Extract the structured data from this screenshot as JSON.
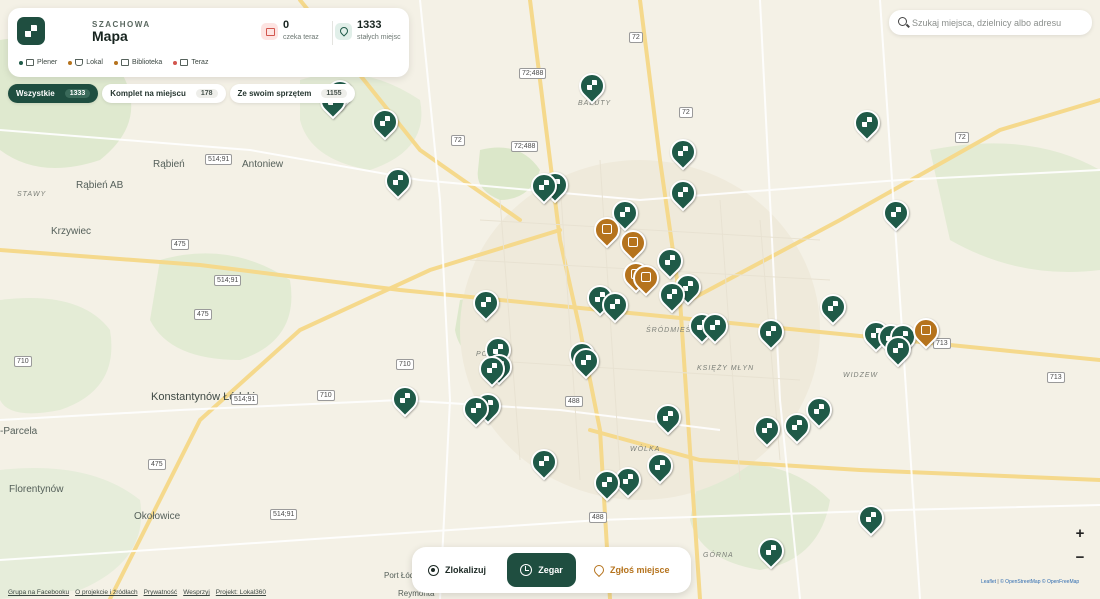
{
  "header": {
    "kicker": "SZACHOWA",
    "title": "Mapa",
    "stats": {
      "waiting": {
        "value": "0",
        "label": "czeka teraz",
        "icon": "chessboard-icon"
      },
      "places": {
        "value": "1333",
        "label": "stałych miejsc",
        "icon": "location-icon"
      }
    },
    "legend": [
      {
        "label": "Plener",
        "color": "#1f5a48",
        "icon": "board-icon"
      },
      {
        "label": "Lokal",
        "color": "#b5731d",
        "icon": "cup-icon"
      },
      {
        "label": "Biblioteka",
        "color": "#b5731d",
        "icon": "book-icon"
      },
      {
        "label": "Teraz",
        "color": "#d2564e",
        "icon": "chessboard-icon"
      }
    ]
  },
  "filters": [
    {
      "label": "Wszystkie",
      "count": "1333",
      "active": true
    },
    {
      "label": "Komplet na miejscu",
      "count": "178",
      "active": false
    },
    {
      "label": "Ze swoim sprzętem",
      "count": "1155",
      "active": false
    }
  ],
  "search": {
    "placeholder": "Szukaj miejsca, dzielnicy albo adresu"
  },
  "bottom_bar": {
    "locate": "Zlokalizuj",
    "clock": "Zegar",
    "report": "Zgłoś miejsce"
  },
  "zoom": {
    "in": "+",
    "out": "−"
  },
  "footer": {
    "links": [
      "Grupa na Facebooku",
      "O projekcie i źródłach",
      "Prywatność",
      "Wesprzyj",
      "Projekt: Lokal360"
    ]
  },
  "attribution": {
    "leaflet": "Leaflet",
    "osm": "© OpenStreetMap",
    "ofm": "© OpenFreeMap",
    "sep": "|"
  },
  "map_labels": {
    "places": [
      "Rąbień",
      "Antoniew",
      "Rąbień AB",
      "Krzywiec",
      "Konstantynów Łódzki",
      "Florentynów",
      "Okołowice",
      "-Parcela",
      "Port Łódź",
      "Reymonta",
      "STAWY"
    ],
    "districts": [
      "BAŁUTY",
      "ŚRÓDMIEŚCIE",
      "KSIĘŻY MŁYN",
      "WIDZEW",
      "WÓLKA",
      "GÓRNA",
      "POL"
    ],
    "roads": [
      "72",
      "72;488",
      "72;488",
      "72",
      "72",
      "72",
      "514;91",
      "475",
      "514;91",
      "475",
      "710",
      "710",
      "710",
      "514;91",
      "475",
      "488",
      "488",
      "713",
      "713",
      "514;91"
    ]
  },
  "colors": {
    "accent": "#1f4e40",
    "marker_green": "#1f5a48",
    "marker_orange": "#b5731d"
  }
}
